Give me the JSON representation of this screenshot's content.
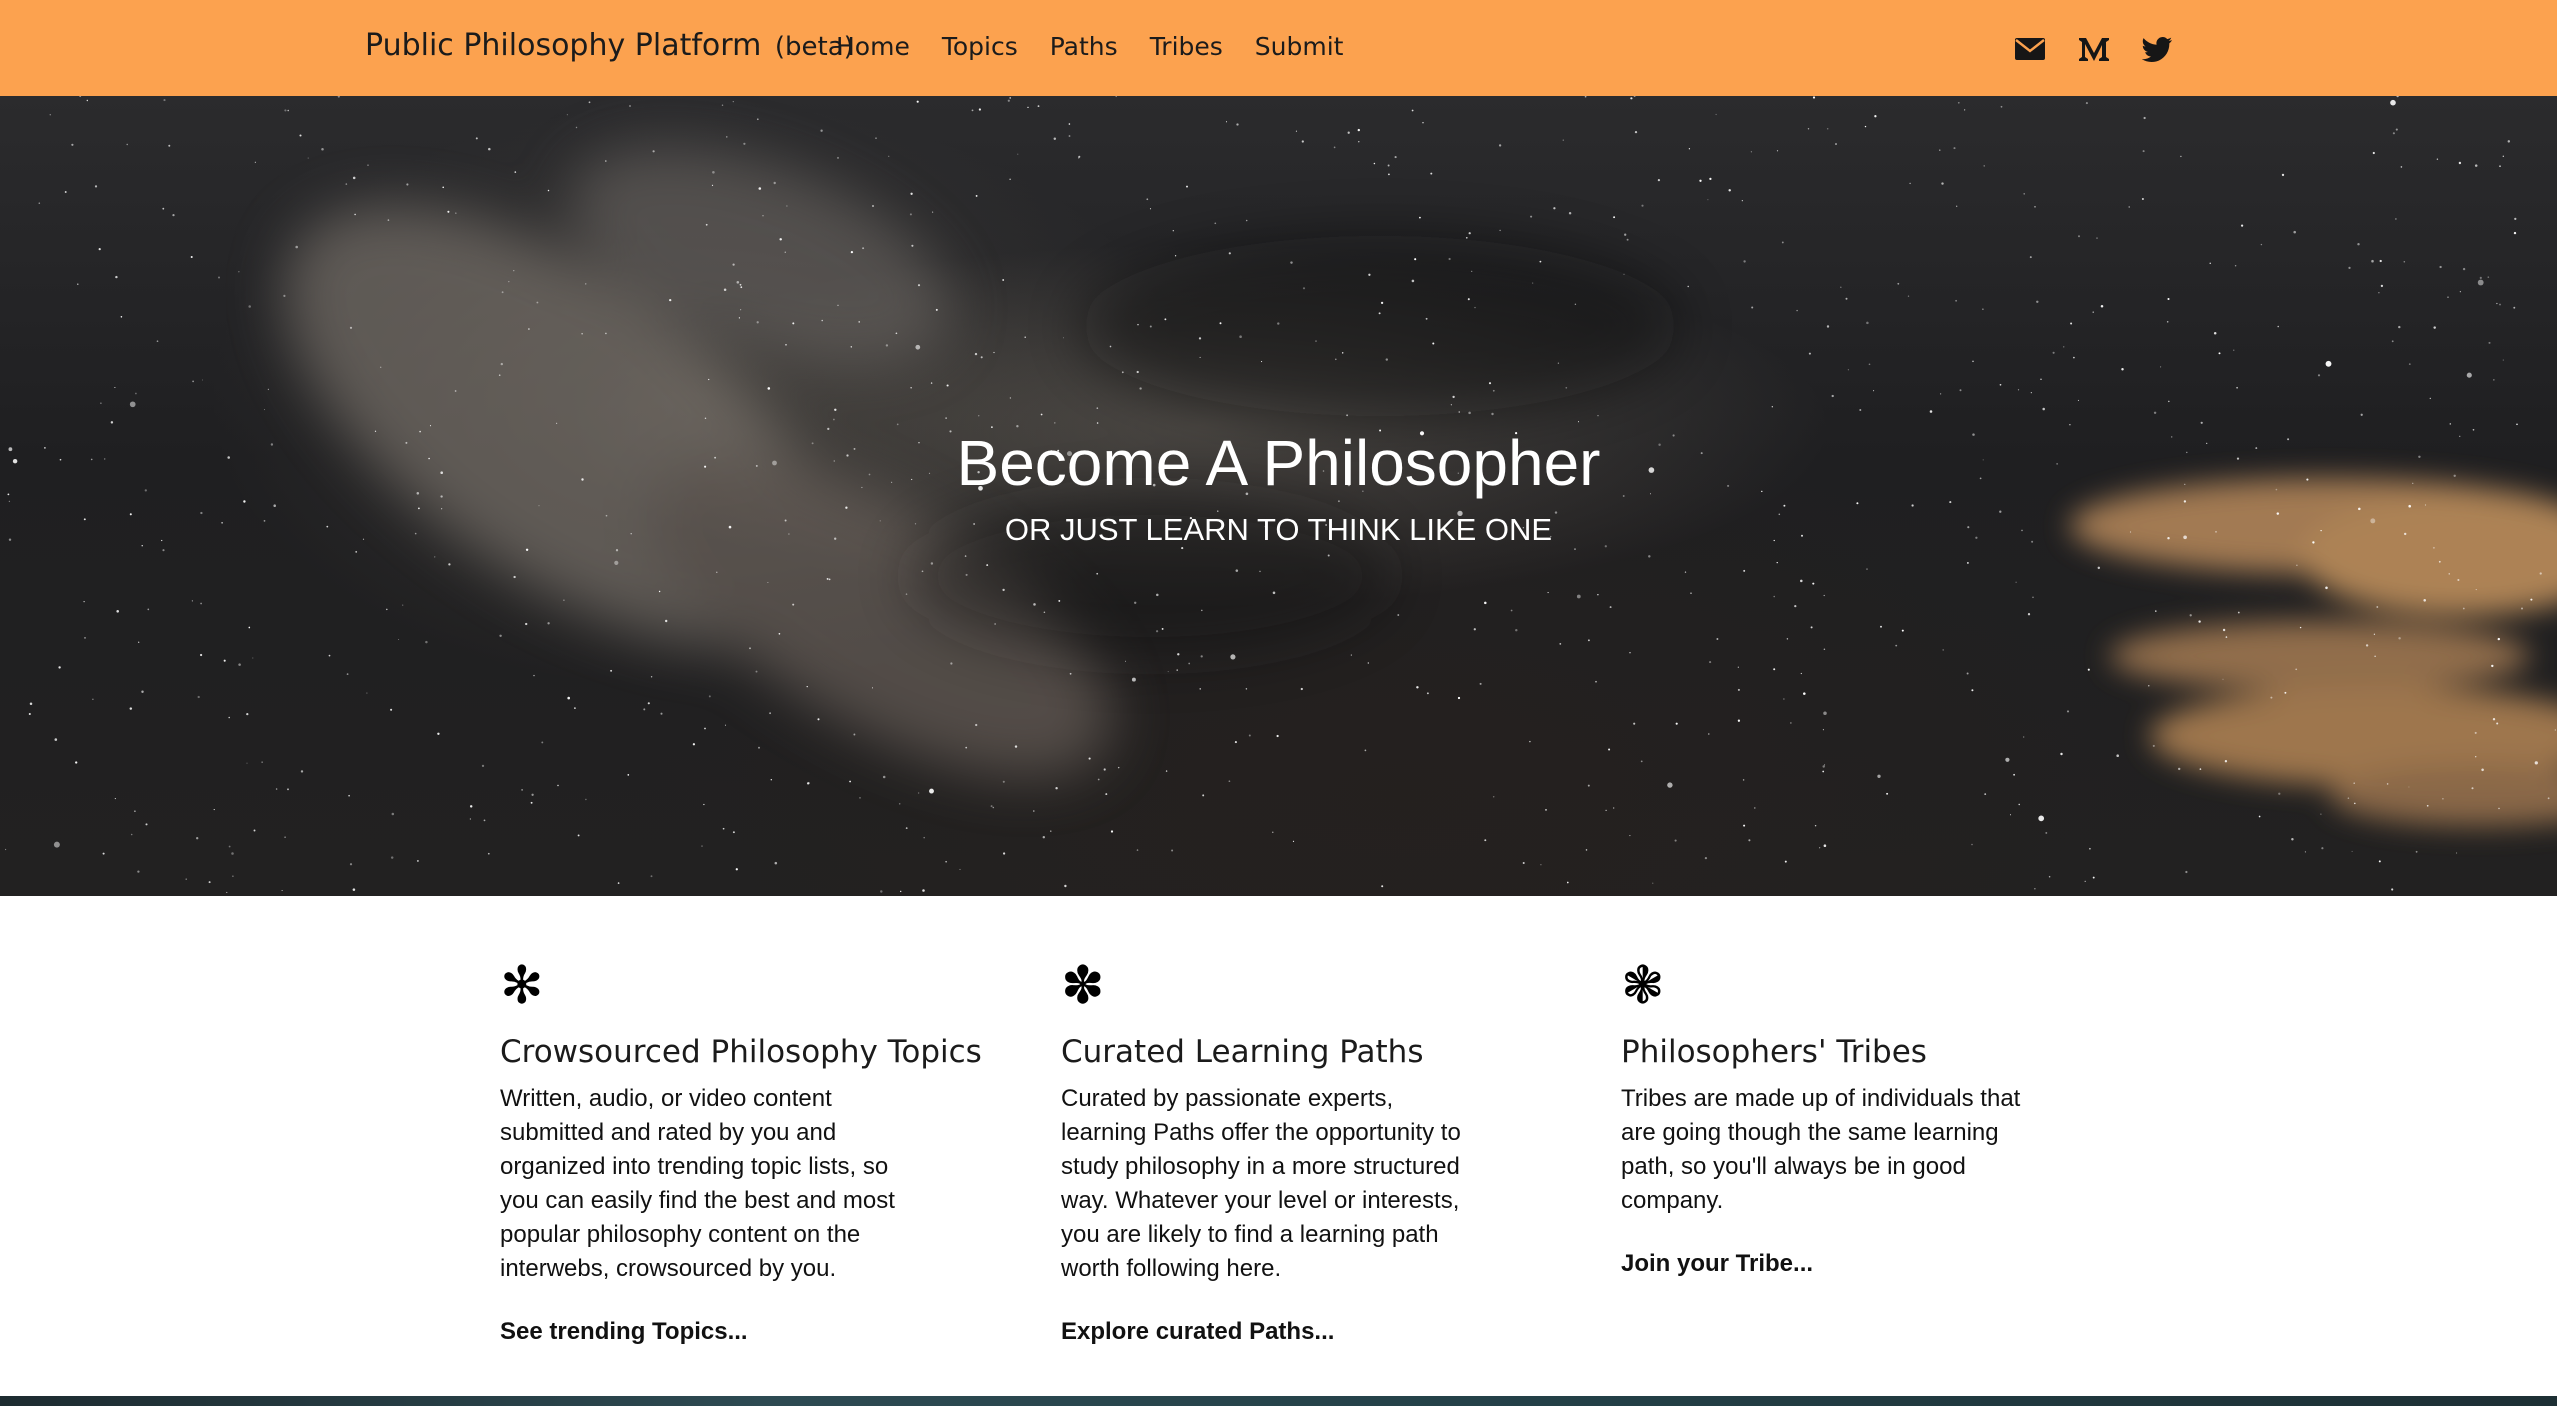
{
  "navbar": {
    "brand": "Public Philosophy Platform",
    "brand_suffix": "(beta)",
    "links": [
      {
        "label": "Home"
      },
      {
        "label": "Topics"
      },
      {
        "label": "Paths"
      },
      {
        "label": "Tribes"
      },
      {
        "label": "Submit"
      }
    ],
    "social_icons": [
      "envelope-icon",
      "medium-icon",
      "twitter-icon"
    ],
    "background_color": "#fca24f"
  },
  "hero": {
    "title": "Become A Philosopher",
    "subtitle": "OR JUST LEARN TO THINK LIKE ONE"
  },
  "features": [
    {
      "icon": "✻",
      "icon_name": "asterisk-flower-icon",
      "title": "Crowsourced Philosophy Topics",
      "body": "Written, audio, or video content submitted and rated by you and organized into trending topic lists, so you can easily find the best and most popular philosophy content on the interwebs, crowsourced by you.",
      "link": "See trending Topics..."
    },
    {
      "icon": "✽",
      "icon_name": "florette-icon",
      "title": "Curated Learning Paths",
      "body": "Curated by passionate experts, learning Paths offer the opportunity to study philosophy in a more structured way. Whatever your level or interests, you are likely to find a learning path worth following here.",
      "link": "Explore curated Paths..."
    },
    {
      "icon": "❃",
      "icon_name": "propeller-flower-icon",
      "title": "Philosophers' Tribes",
      "body": "Tribes are made up of individuals that are going though the same learning path, so you'll always be in good company.",
      "link": "Join your Tribe..."
    }
  ]
}
